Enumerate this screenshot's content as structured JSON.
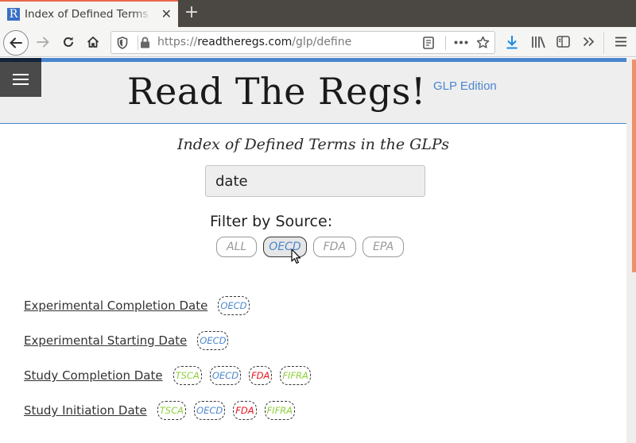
{
  "browser": {
    "tab": {
      "title": "Index of Defined Terms in the GLPs",
      "favicon": "R"
    },
    "url": {
      "scheme": "https://",
      "host": "readtheregs.com",
      "path": "/glp/define"
    },
    "icons": [
      "back-icon",
      "forward-icon",
      "reload-icon",
      "home-icon",
      "shield-icon",
      "lock-icon",
      "reader-view-icon",
      "more-actions-icon",
      "bookmark-star-icon",
      "download-icon",
      "library-icon",
      "sidebar-icon",
      "overflow-icon",
      "hamburger-menu-icon"
    ],
    "accent_color": "#e8694a",
    "download_color": "#1a8ae6"
  },
  "header": {
    "title": "Read The Regs!",
    "edition": "GLP Edition",
    "accent_color": "#4a86cf"
  },
  "main": {
    "subtitle": "Index of Defined Terms in the GLPs",
    "search": {
      "value": "date",
      "placeholder": ""
    },
    "filter_label": "Filter by Source:",
    "filters": [
      {
        "label": "ALL",
        "active": false
      },
      {
        "label": "OECD",
        "active": true
      },
      {
        "label": "FDA",
        "active": false
      },
      {
        "label": "EPA",
        "active": false
      }
    ],
    "terms": [
      {
        "label": "Experimental Completion Date",
        "tags": [
          "OECD"
        ]
      },
      {
        "label": "Experimental Starting Date",
        "tags": [
          "OECD"
        ]
      },
      {
        "label": "Study Completion Date",
        "tags": [
          "TSCA",
          "OECD",
          "FDA",
          "FIFRA"
        ]
      },
      {
        "label": "Study Initiation Date",
        "tags": [
          "TSCA",
          "OECD",
          "FDA",
          "FIFRA"
        ]
      }
    ],
    "tag_colors": {
      "TSCA": "#8fcf3c",
      "OECD": "#4a86cf",
      "FDA": "#e8131f",
      "FIFRA": "#8fcf3c"
    }
  }
}
